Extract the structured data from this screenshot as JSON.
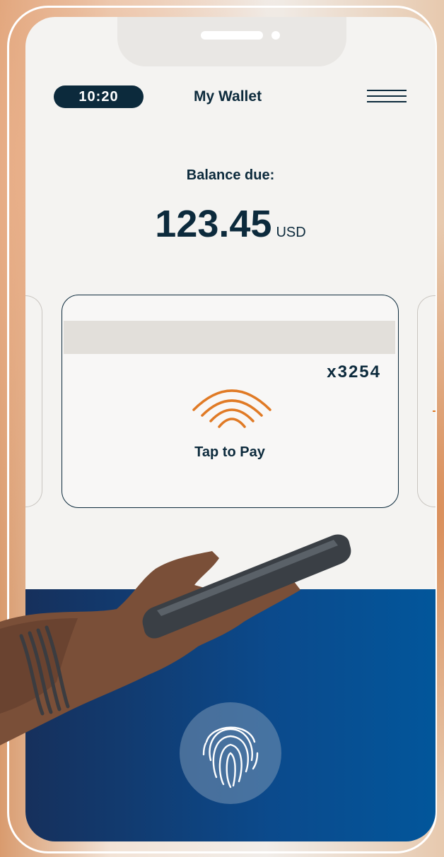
{
  "status_bar": {
    "time": "10:20"
  },
  "header": {
    "title": "My Wallet",
    "menu_icon": "hamburger-menu-icon"
  },
  "balance": {
    "label": "Balance due:",
    "amount": "123.45",
    "currency": "USD"
  },
  "card": {
    "number": "x3254",
    "action_label": "Tap to Pay",
    "action_icon": "contactless-icon"
  },
  "auth": {
    "icon": "fingerprint-icon"
  },
  "colors": {
    "primary": "#0c2a3c",
    "accent": "#e07a25",
    "panel": "#0b4a8c"
  }
}
